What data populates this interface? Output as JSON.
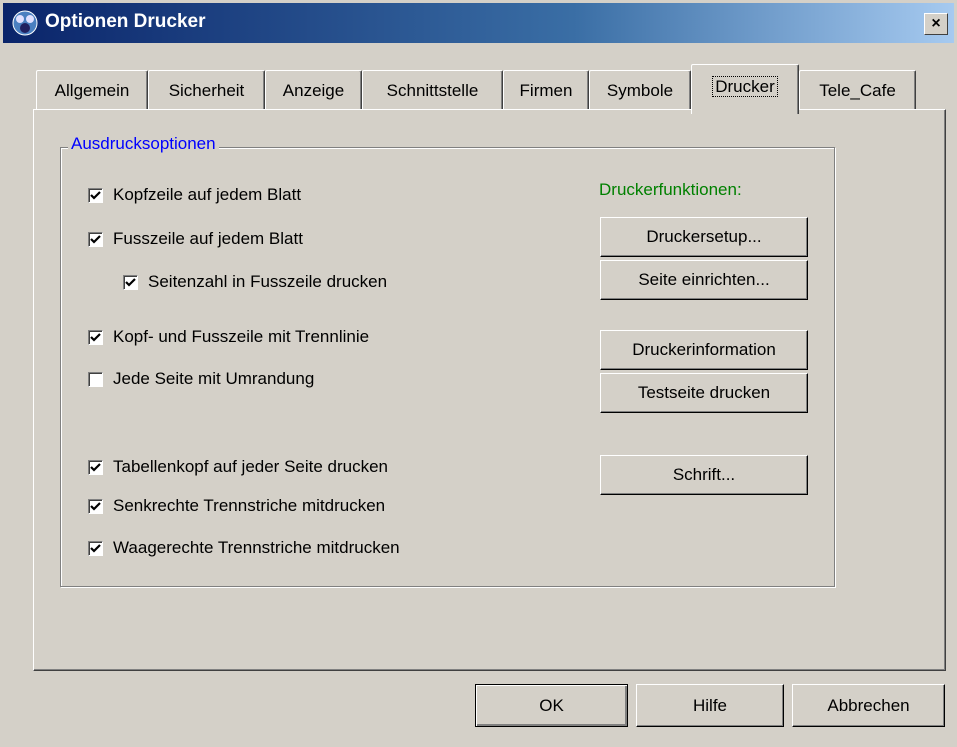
{
  "window": {
    "title": "Optionen Drucker",
    "close_label": "×"
  },
  "tabs": [
    {
      "label": "Allgemein"
    },
    {
      "label": "Sicherheit"
    },
    {
      "label": "Anzeige"
    },
    {
      "label": "Schnittstelle"
    },
    {
      "label": "Firmen"
    },
    {
      "label": "Symbole"
    },
    {
      "label": "Drucker",
      "active": true
    },
    {
      "label": "Tele_Cafe"
    }
  ],
  "group": {
    "legend": "Ausdrucksoptionen"
  },
  "options": [
    {
      "label": "Kopfzeile auf jedem Blatt",
      "checked": true
    },
    {
      "label": "Fusszeile auf jedem Blatt",
      "checked": true
    },
    {
      "label": "Seitenzahl in Fusszeile drucken",
      "checked": true
    },
    {
      "label": "Kopf- und Fusszeile mit Trennlinie",
      "checked": true
    },
    {
      "label": "Jede Seite mit Umrandung",
      "checked": false
    },
    {
      "label": "Tabellenkopf auf jeder Seite drucken",
      "checked": true
    },
    {
      "label": "Senkrechte Trennstriche mitdrucken",
      "checked": true
    },
    {
      "label": "Waagerechte Trennstriche mitdrucken",
      "checked": true
    }
  ],
  "printer_functions": {
    "heading": "Druckerfunktionen:",
    "heading_color": "#008000",
    "buttons": [
      {
        "label": "Druckersetup..."
      },
      {
        "label": "Seite einrichten..."
      },
      {
        "label": "Druckerinformation"
      },
      {
        "label": "Testseite drucken"
      },
      {
        "label": "Schrift..."
      }
    ]
  },
  "footer": {
    "ok_label": "OK",
    "help_label": "Hilfe",
    "cancel_label": "Abbrechen"
  },
  "colors": {
    "title_gradient_start": "#0a246a",
    "title_gradient_end": "#a6caf0",
    "legend": "#0000ff",
    "face": "#d4d0c8"
  }
}
